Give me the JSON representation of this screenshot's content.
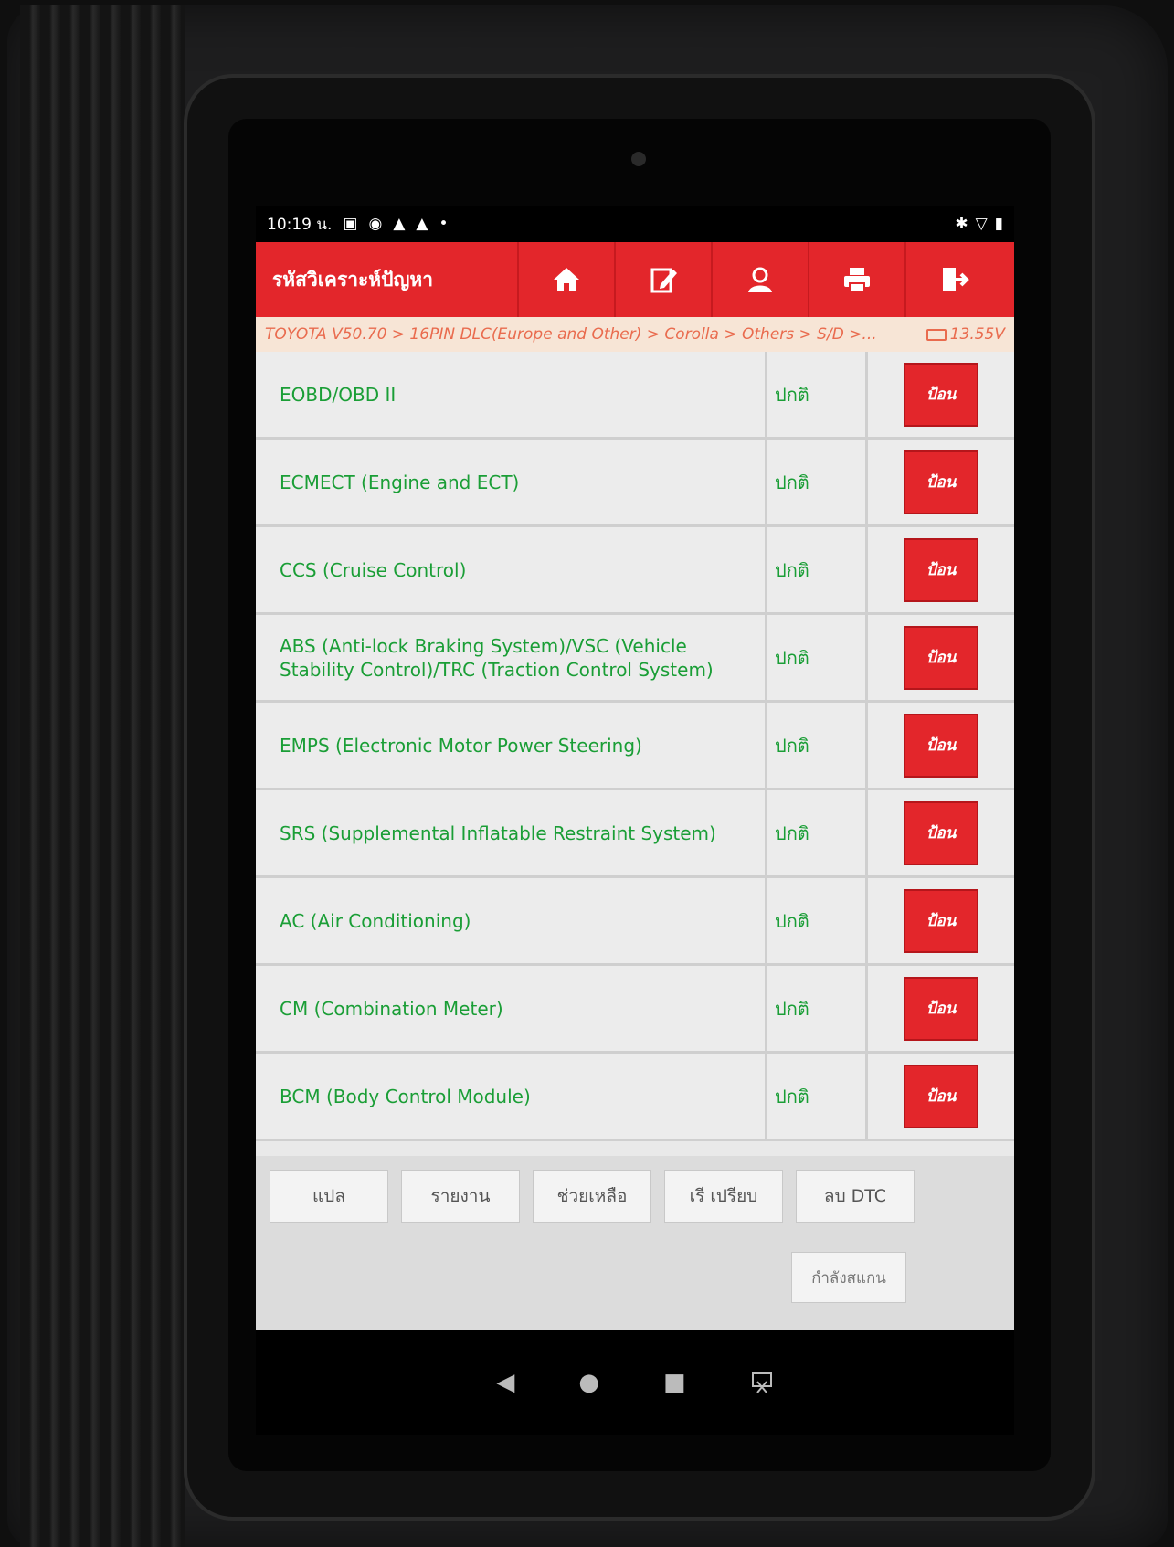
{
  "status_bar": {
    "time": "10:19 น.",
    "left_icons": [
      "calendar-icon",
      "cast-icon",
      "warning-icon",
      "warning-icon",
      "dot-icon"
    ],
    "right_icons": [
      "bluetooth-icon",
      "wifi-icon",
      "battery-icon"
    ]
  },
  "header": {
    "title": "รหัสวิเคราะห์ปัญหา",
    "toolbar_icons": [
      "home-icon",
      "edit-icon",
      "user-icon",
      "print-icon",
      "exit-icon"
    ]
  },
  "breadcrumb": {
    "path": "TOYOTA V50.70 > 16PIN DLC(Europe and Other) > Corolla > Others > S/D >...",
    "voltage": "13.55V"
  },
  "systems": [
    {
      "name": "EOBD/OBD II",
      "status": "ปกติ",
      "action": "ป้อน"
    },
    {
      "name": "ECMECT (Engine and ECT)",
      "status": "ปกติ",
      "action": "ป้อน"
    },
    {
      "name": "CCS (Cruise Control)",
      "status": "ปกติ",
      "action": "ป้อน"
    },
    {
      "name": "ABS (Anti-lock Braking System)/VSC (Vehicle Stability Control)/TRC (Traction Control System)",
      "status": "ปกติ",
      "action": "ป้อน"
    },
    {
      "name": "EMPS (Electronic Motor Power Steering)",
      "status": "ปกติ",
      "action": "ป้อน"
    },
    {
      "name": "SRS (Supplemental Inflatable Restraint System)",
      "status": "ปกติ",
      "action": "ป้อน"
    },
    {
      "name": "AC (Air Conditioning)",
      "status": "ปกติ",
      "action": "ป้อน"
    },
    {
      "name": "CM (Combination Meter)",
      "status": "ปกติ",
      "action": "ป้อน"
    },
    {
      "name": "BCM (Body Control Module)",
      "status": "ปกติ",
      "action": "ป้อน"
    }
  ],
  "bottom_buttons": {
    "translate": "แปล",
    "report": "รายงาน",
    "help": "ช่วยเหลือ",
    "compare": "เรี  เปรียบ",
    "clear_dtc": "ลบ DTC",
    "scanning": "กำลังสแกน"
  },
  "nav": {
    "back_icon": "◀",
    "home_icon": "●",
    "recent_icon": "■",
    "screenshot_icon": "screenshot-icon"
  },
  "colors": {
    "accent_red": "#e3262b",
    "status_green": "#1a9e36",
    "breadcrumb_text": "#e96b4e"
  }
}
